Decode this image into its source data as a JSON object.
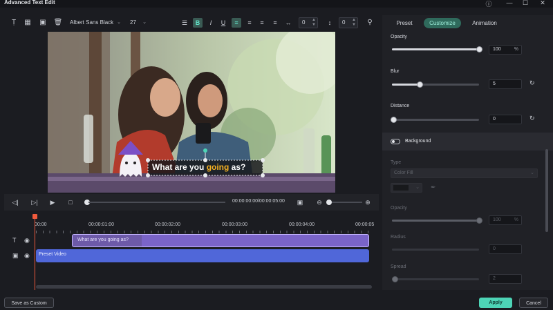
{
  "window": {
    "title": "Advanced Text Edit"
  },
  "toolbar": {
    "font_family": "Albert Sans Black",
    "font_size": "27",
    "letter_spacing": "0",
    "line_spacing": "0"
  },
  "caption_text": "What are you going as?",
  "playback": {
    "timecode": "00:00:00:00/00:00:05:00"
  },
  "timeline": {
    "ruler": [
      "00:00",
      "00:00:01:00",
      "00:00:02:00",
      "00:00:03:00",
      "00:00:04:00",
      "00:00:05"
    ],
    "text_clip_label": "What are you going as?",
    "video_clip_label": "Preset Video"
  },
  "panel": {
    "tabs": [
      "Preset",
      "Customize",
      "Animation"
    ],
    "active_tab": "Customize",
    "opacity": {
      "label": "Opacity",
      "value": "100",
      "unit": "%",
      "level": 1.0
    },
    "blur": {
      "label": "Blur",
      "value": "5",
      "level": 0.32
    },
    "distance": {
      "label": "Distance",
      "value": "0",
      "level": 0.0
    },
    "background": {
      "label": "Background",
      "type_label": "Type",
      "type_value": "Color Fill",
      "opacity_label": "Opacity",
      "opacity_value": "100",
      "opacity_unit": "%",
      "opacity_level": 1.0,
      "radius_label": "Radius",
      "radius_value": "0",
      "spread_label": "Spread",
      "spread_value": "2",
      "spread_level": 0.02
    }
  },
  "footer": {
    "save_custom": "Save as Custom",
    "apply": "Apply",
    "cancel": "Cancel"
  },
  "colors": {
    "accent": "#4dd4b6",
    "clip_text": "#7a64c8",
    "clip_video": "#5067d9",
    "playhead": "#f05a3d"
  }
}
